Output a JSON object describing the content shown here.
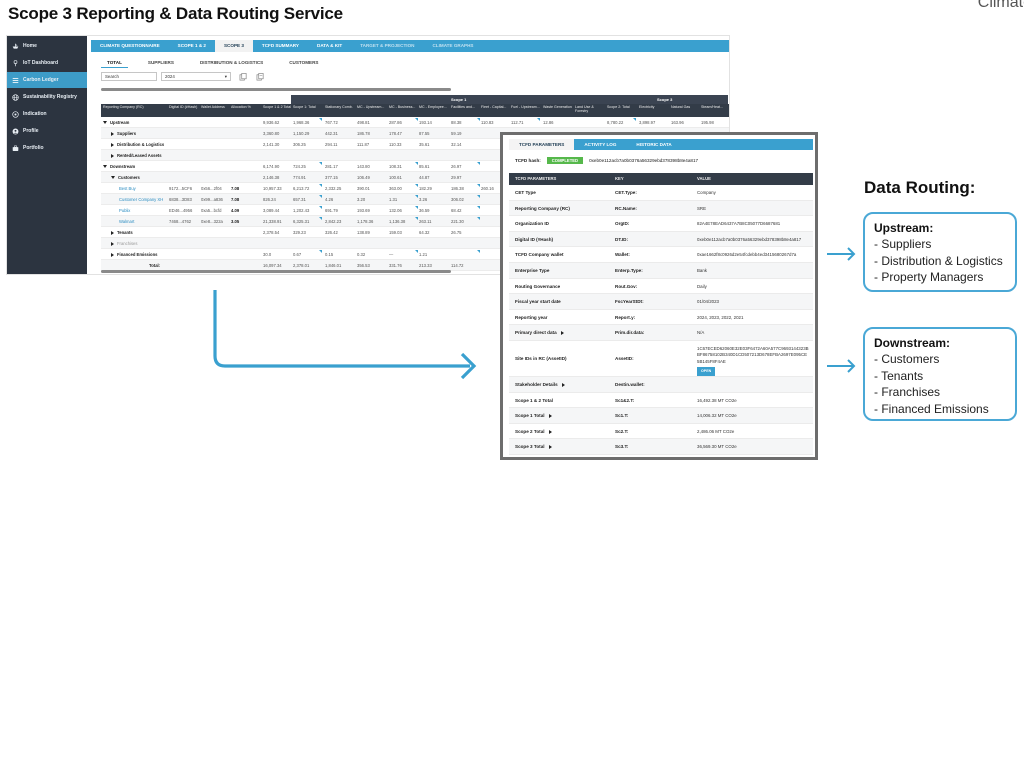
{
  "slide": {
    "title": "Scope 3 Reporting & Data Routing Service",
    "corner_word": "Climate"
  },
  "sidebar": {
    "items": [
      {
        "label": "Home",
        "icon": "ship-icon",
        "active": false
      },
      {
        "label": "IoT Dashboard",
        "icon": "plug-icon",
        "active": false
      },
      {
        "label": "Carbon Ledger",
        "icon": "list-icon",
        "active": true
      },
      {
        "label": "Sustainability Registry",
        "icon": "globe-icon",
        "active": false
      },
      {
        "label": "Indication",
        "icon": "target-icon",
        "active": false
      },
      {
        "label": "Profile",
        "icon": "user-icon",
        "active": false
      },
      {
        "label": "Portfolio",
        "icon": "briefcase-icon",
        "active": false
      }
    ]
  },
  "main_tabs": [
    "CLIMATE QUESTIONNAIRE",
    "SCOPE 1 & 2",
    "SCOPE 3",
    "TCFD SUMMARY",
    "DATA & KIT",
    "TARGET & PROJECTION",
    "CLIMATE GRAPHS"
  ],
  "main_tabs_active": "SCOPE 3",
  "sub_tabs": [
    "TOTAL",
    "SUPPLIERS",
    "DISTRIBUTION & LOGISTICS",
    "CUSTOMERS"
  ],
  "filters": {
    "search_placeholder": "Search",
    "year": "2024"
  },
  "grid": {
    "scope_groups": [
      "Scope 1",
      "Scope 3"
    ],
    "headers": [
      "Reporting Company (RC)",
      "Digital ID (#Hash)",
      "Wallet Address",
      "Allocation %",
      "Scope 1 & 2 Total",
      "Scope 1: Total",
      "Stationary Comb.",
      "MC - Upstream...",
      "MC - Business...",
      "MC - Employee...",
      "Facilities and...",
      "Fleet - Capital...",
      "Fuel - Upstream...",
      "Waste Generation",
      "Land Use & Forestry",
      "Scope 2: Total",
      "Electricity",
      "Natural Gas",
      "Steam/Heat..."
    ],
    "rows": [
      {
        "name": "Upstream",
        "level": 0,
        "caret": "down",
        "cells": [
          "",
          "",
          "",
          "9,936.62",
          "1,968.36",
          "767.72",
          "498.81",
          "287.86",
          "193.14",
          "88.38",
          "110.83",
          "112.71",
          "12.86",
          "",
          "8,780.22",
          "3,898.97",
          "163.96",
          "195.98"
        ]
      },
      {
        "name": "Suppliers",
        "level": 1,
        "caret": "right",
        "cells": [
          "",
          "",
          "",
          "3,360.80",
          "1,150.29",
          "442.31",
          "186.78",
          "178.47",
          "87.55",
          "59.19",
          "",
          "",
          "",
          "",
          "2,213.30",
          "1,170.60",
          "48.60",
          "59.48"
        ]
      },
      {
        "name": "Distribution & Logistics",
        "level": 1,
        "caret": "right",
        "cells": [
          "",
          "",
          "",
          "2,141.30",
          "306.25",
          "294.11",
          "111.87",
          "110.33",
          "35.61",
          "32.14",
          "",
          "",
          "",
          "",
          "1,834.06",
          "1,180.44",
          "59.18",
          "40.71"
        ]
      },
      {
        "name": "Rented/Leased Assets",
        "level": 1,
        "caret": "right",
        "cells": [
          "",
          "",
          "",
          "",
          "",
          "",
          "",
          "",
          "",
          "",
          "",
          "",
          "",
          "",
          "",
          "",
          "",
          ""
        ]
      },
      {
        "name": "Downstream",
        "level": 0,
        "caret": "down",
        "cells": [
          "",
          "",
          "",
          "6,174.90",
          "724.25",
          "281.17",
          "143.80",
          "108.31",
          "85.61",
          "26.97",
          "",
          "",
          "",
          "",
          "5,426.40",
          "2,107.88",
          "89.15",
          "74.48"
        ]
      },
      {
        "name": "Customers",
        "level": 1,
        "caret": "down",
        "cells": [
          "",
          "",
          "",
          "2,146.38",
          "774.91",
          "377.15",
          "106.49",
          "100.61",
          "44.87",
          "29.97",
          "",
          "",
          "",
          "",
          "1,371.48",
          "1,100.03",
          "44.42",
          "41.43"
        ]
      },
      {
        "name": "Best Buy",
        "level": 2,
        "link": true,
        "cells": [
          "9172...5CF6",
          "0x56...2f04",
          "7.08",
          "10,957.33",
          "6,213.72",
          "2,332.25",
          "390.01",
          "363.00",
          "182.29",
          "186.38",
          "260.16",
          "",
          "",
          "",
          "4,743.61",
          "2,208.11",
          "",
          ""
        ]
      },
      {
        "name": "Customer Company XH",
        "level": 2,
        "link": true,
        "cells": [
          "6838...3D83",
          "0x99...a836",
          "7.08",
          "826.24",
          "657.31",
          "4.26",
          "3.20",
          "1.31",
          "3.26",
          "306.02",
          "",
          "",
          "",
          "",
          "168.93",
          "",
          "",
          ""
        ]
      },
      {
        "name": "Publix",
        "level": 2,
        "link": true,
        "cells": [
          "ED46...4956",
          "0xa5...bcfd",
          "4.09",
          "3,089.44",
          "1,202.43",
          "691.79",
          "193.69",
          "132.06",
          "36.59",
          "68.42",
          "",
          "",
          "",
          "",
          "1,887.01",
          "",
          "",
          ""
        ]
      },
      {
        "name": "Walmart",
        "level": 2,
        "link": true,
        "cells": [
          "7468...4762",
          "0xe8...322a",
          "3.05",
          "21,338.91",
          "6,325.31",
          "2,842.23",
          "1,178.36",
          "1,136.38",
          "263.11",
          "221.30",
          "",
          "",
          "",
          "",
          "15,013.60",
          "",
          "",
          ""
        ]
      },
      {
        "name": "Tenants",
        "level": 1,
        "caret": "right",
        "cells": [
          "",
          "",
          "",
          "2,378.54",
          "329.23",
          "326.42",
          "138.89",
          "159.03",
          "64.32",
          "26.75",
          "",
          "",
          "",
          "",
          "2,049.31",
          "",
          "",
          ""
        ]
      },
      {
        "name": "Franchises",
        "level": 1,
        "caret": "right",
        "grey": true,
        "cells": [
          "",
          "",
          "",
          "",
          "",
          "",
          "",
          "",
          "",
          "",
          "",
          "",
          "",
          "",
          "",
          "",
          "",
          ""
        ]
      },
      {
        "name": "Financed Emissions",
        "level": 1,
        "caret": "right",
        "cells": [
          "",
          "",
          "",
          "30.0",
          "0.67",
          "0.15",
          "0.32",
          "—",
          "1.21",
          "",
          "",
          "",
          "",
          "",
          "29.33",
          "",
          "",
          ""
        ]
      },
      {
        "name": "Total:",
        "level": 3,
        "cells": [
          "",
          "",
          "",
          "16,097.34",
          "2,378.01",
          "1,846.01",
          "356.53",
          "331.76",
          "213.33",
          "114.72",
          "",
          "",
          "",
          "",
          "13,719.33",
          "",
          "",
          ""
        ]
      }
    ]
  },
  "tcfd": {
    "tabs": [
      "TCFD PARAMETERS",
      "ACTIVITY LOG",
      "HISTORIC DATA"
    ],
    "active_tab": "TCFD PARAMETERS",
    "hash_label": "TCFD hash:",
    "status": "COMPLETED",
    "hash_value": "0xeb0e112acb7a0b0376a56329ebd378398b8e4a817",
    "columns": [
      "TCFD PARAMETERS",
      "KEY",
      "VALUE"
    ],
    "rows": [
      {
        "param": "CET Type",
        "key": "CET.Type:",
        "value": "Company"
      },
      {
        "param": "Reporting Company (RC)",
        "key": "RC.Name:",
        "value": "SRE"
      },
      {
        "param": "Organization ID",
        "key": "OrgID:",
        "value": "82A4E78EAD6437A7B8C05077D6687681"
      },
      {
        "param": "Digital ID (#Hash)",
        "key": "DT.ID:",
        "value": "0xeb0e112acb7a0b0376a56329ebd378398b8e4a817"
      },
      {
        "param": "TCFD Company wallet",
        "key": "Wallet:",
        "value": "0xae1662f8c0926d2e54fcdebb4ed3415680267d7a"
      },
      {
        "param": "Enterprise Type",
        "key": "Enterp.Type:",
        "value": "Bank"
      },
      {
        "param": "Routing Governance",
        "key": "Rout.Gov:",
        "value": "Daily"
      },
      {
        "param": "Fiscal year start date",
        "key": "FscYearStDt:",
        "value": "01/04/2023"
      },
      {
        "param": "Reporting year",
        "key": "Report.y:",
        "value": "2024, 2023, 2022, 2021"
      },
      {
        "param": "Primary direct data",
        "key": "Prim.dir.data:",
        "value": "N/A",
        "expand": true
      },
      {
        "param": "Site IDs in RC (AssetID)",
        "key": "AssetID:",
        "value": "1C67ECED62060E32E03F6472A60A577C9693144323BBF86758102B340D1CD507213D678EFBA2697E095CE5B145F8F4AE",
        "tall": true,
        "button": "OPEN"
      },
      {
        "param": "Stakeholder Details",
        "key": "Destin.wallet:",
        "value": "",
        "expand": true
      },
      {
        "param": "Scope 1 & 2 Total",
        "key": "Sc1&2.T:",
        "value": "16,492.38 MT CO2e"
      },
      {
        "param": "Scope 1 Total",
        "key": "Sc1.T:",
        "value": "14,006.32 MT CO2e",
        "expand": true
      },
      {
        "param": "Scope 2 Total",
        "key": "Sc2.T:",
        "value": "2,486.06 MT CO2e",
        "expand": true
      },
      {
        "param": "Scope 3 Total",
        "key": "Sc3.T:",
        "value": "36,569.30 MT CO2e",
        "expand": true
      }
    ]
  },
  "routing": {
    "title": "Data Routing:",
    "upstream": {
      "title": "Upstream:",
      "items": [
        "Suppliers",
        "Distribution & Logistics",
        "Property Managers"
      ]
    },
    "downstream": {
      "title": "Downstream:",
      "items": [
        "Customers",
        "Tenants",
        "Franchises",
        "Financed Emissions"
      ]
    }
  },
  "colors": {
    "accent": "#3aa0cf",
    "sidebar": "#2c3440",
    "header": "#333c48",
    "completed": "#56b84b",
    "routing_border": "#4aa8d6"
  }
}
